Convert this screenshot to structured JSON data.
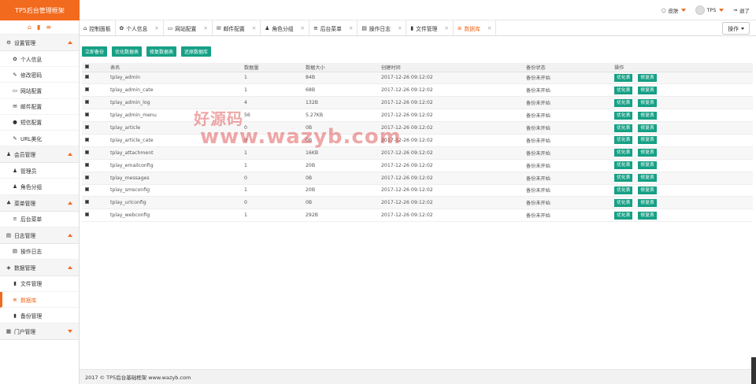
{
  "header": {
    "logo": "TP5后台管理框架",
    "skin": "皮肤",
    "user": "TP5",
    "logout": "退了"
  },
  "sidebar": {
    "tools": [
      "home-icon",
      "delete-icon",
      "menu-icon"
    ],
    "groups": [
      {
        "label": "设置管理",
        "icon": "⚙",
        "expanded": true,
        "items": [
          {
            "label": "个人信息",
            "icon": "✿"
          },
          {
            "label": "修改密码",
            "icon": "✎"
          },
          {
            "label": "网站配置",
            "icon": "▭"
          },
          {
            "label": "邮件配置",
            "icon": "✉"
          },
          {
            "label": "短信配置",
            "icon": "●"
          },
          {
            "label": "URL美化",
            "icon": "✎"
          }
        ]
      },
      {
        "label": "会员管理",
        "icon": "♟",
        "expanded": true,
        "items": [
          {
            "label": "管理员",
            "icon": "♟"
          },
          {
            "label": "角色分组",
            "icon": "♟"
          }
        ]
      },
      {
        "label": "菜单管理",
        "icon": "♣",
        "expanded": true,
        "items": [
          {
            "label": "后台菜单",
            "icon": "≡"
          }
        ]
      },
      {
        "label": "日志管理",
        "icon": "▤",
        "expanded": true,
        "items": [
          {
            "label": "操作日志",
            "icon": "▤"
          }
        ]
      },
      {
        "label": "数据管理",
        "icon": "◈",
        "expanded": true,
        "items": [
          {
            "label": "文件管理",
            "icon": "▮"
          },
          {
            "label": "数据库",
            "icon": "≣",
            "active": true
          },
          {
            "label": "备份管理",
            "icon": "▮"
          }
        ]
      },
      {
        "label": "门户管理",
        "icon": "▦",
        "expanded": false,
        "items": []
      }
    ]
  },
  "tabs": [
    {
      "label": "控制面板",
      "icon": "⌂",
      "closable": false
    },
    {
      "label": "个人信息",
      "icon": "✿",
      "closable": true
    },
    {
      "label": "网站配置",
      "icon": "▭",
      "closable": true
    },
    {
      "label": "邮件配置",
      "icon": "✉",
      "closable": true
    },
    {
      "label": "角色分组",
      "icon": "♟",
      "closable": true
    },
    {
      "label": "后台菜单",
      "icon": "≡",
      "closable": true
    },
    {
      "label": "操作日志",
      "icon": "▤",
      "closable": true
    },
    {
      "label": "文件管理",
      "icon": "▮",
      "closable": true
    },
    {
      "label": "数据库",
      "icon": "≣",
      "closable": true,
      "active": true
    }
  ],
  "ops_label": "操作",
  "toolbar": [
    "立即备份",
    "优化数据表",
    "修复数据表",
    "还原数据库"
  ],
  "table": {
    "headers": [
      "",
      "表名",
      "数据量",
      "数据大小",
      "创建时间",
      "备份状态",
      "操作"
    ],
    "rows": [
      [
        "tplay_admin",
        "1",
        "84B",
        "2017-12-26 09:12:02",
        "备份未开始"
      ],
      [
        "tplay_admin_cate",
        "1",
        "68B",
        "2017-12-26 09:12:02",
        "备份未开始"
      ],
      [
        "tplay_admin_log",
        "4",
        "132B",
        "2017-12-26 09:12:02",
        "备份未开始"
      ],
      [
        "tplay_admin_menu",
        "56",
        "5.27KB",
        "2017-12-26 09:12:02",
        "备份未开始"
      ],
      [
        "tplay_article",
        "0",
        "0B",
        "2017-12-26 09:12:02",
        "备份未开始"
      ],
      [
        "tplay_article_cate",
        "0",
        "0B",
        "2017-12-26 09:12:02",
        "备份未开始"
      ],
      [
        "tplay_attachment",
        "1",
        "16KB",
        "2017-12-26 09:12:02",
        "备份未开始"
      ],
      [
        "tplay_emailconfig",
        "1",
        "20B",
        "2017-12-26 09:12:02",
        "备份未开始"
      ],
      [
        "tplay_messages",
        "0",
        "0B",
        "2017-12-26 09:12:02",
        "备份未开始"
      ],
      [
        "tplay_smsconfig",
        "1",
        "20B",
        "2017-12-26 09:12:02",
        "备份未开始"
      ],
      [
        "tplay_urlconfig",
        "0",
        "0B",
        "2017-12-26 09:12:02",
        "备份未开始"
      ],
      [
        "tplay_webconfig",
        "1",
        "292B",
        "2017-12-26 09:12:02",
        "备份未开始"
      ]
    ],
    "optimize_label": "优化表",
    "repair_label": "修复表"
  },
  "watermark": {
    "cn": "好源码",
    "url": "www.wazyb.com"
  },
  "footer": "2017 © TP5后台基础框架 www.wazyb.com",
  "colors": {
    "accent": "#f26a1d",
    "button": "#16a085"
  }
}
